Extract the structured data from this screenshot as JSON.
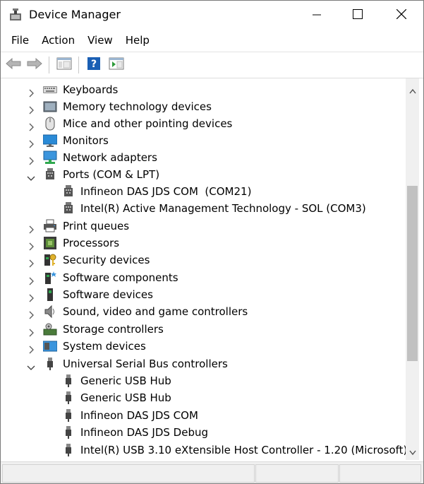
{
  "window": {
    "title": "Device Manager"
  },
  "menu": [
    {
      "label": "File"
    },
    {
      "label": "Action"
    },
    {
      "label": "View"
    },
    {
      "label": "Help"
    }
  ],
  "tree": {
    "items": [
      {
        "label": "Keyboards",
        "expanded": false,
        "level": 0,
        "icon": "keyboard-icon"
      },
      {
        "label": "Memory technology devices",
        "expanded": false,
        "level": 0,
        "icon": "memory-icon"
      },
      {
        "label": "Mice and other pointing devices",
        "expanded": false,
        "level": 0,
        "icon": "mouse-icon"
      },
      {
        "label": "Monitors",
        "expanded": false,
        "level": 0,
        "icon": "monitor-icon"
      },
      {
        "label": "Network adapters",
        "expanded": false,
        "level": 0,
        "icon": "network-adapter-icon"
      },
      {
        "label": "Ports (COM & LPT)",
        "expanded": true,
        "level": 0,
        "icon": "port-icon"
      },
      {
        "label": "Infineon DAS JDS COM  (COM21)",
        "level": 1,
        "icon": "port-icon"
      },
      {
        "label": "Intel(R) Active Management Technology - SOL (COM3)",
        "level": 1,
        "icon": "port-icon"
      },
      {
        "label": "Print queues",
        "expanded": false,
        "level": 0,
        "icon": "printer-icon"
      },
      {
        "label": "Processors",
        "expanded": false,
        "level": 0,
        "icon": "processor-icon"
      },
      {
        "label": "Security devices",
        "expanded": false,
        "level": 0,
        "icon": "security-key-icon"
      },
      {
        "label": "Software components",
        "expanded": false,
        "level": 0,
        "icon": "software-component-icon"
      },
      {
        "label": "Software devices",
        "expanded": false,
        "level": 0,
        "icon": "software-device-icon"
      },
      {
        "label": "Sound, video and game controllers",
        "expanded": false,
        "level": 0,
        "icon": "speaker-icon"
      },
      {
        "label": "Storage controllers",
        "expanded": false,
        "level": 0,
        "icon": "storage-controller-icon"
      },
      {
        "label": "System devices",
        "expanded": false,
        "level": 0,
        "icon": "system-device-icon"
      },
      {
        "label": "Universal Serial Bus controllers",
        "expanded": true,
        "level": 0,
        "icon": "usb-icon"
      },
      {
        "label": "Generic USB Hub",
        "level": 1,
        "icon": "usb-icon"
      },
      {
        "label": "Generic USB Hub",
        "level": 1,
        "icon": "usb-icon"
      },
      {
        "label": "Infineon DAS JDS COM",
        "level": 1,
        "icon": "usb-icon"
      },
      {
        "label": "Infineon DAS JDS Debug",
        "level": 1,
        "icon": "usb-icon"
      },
      {
        "label": "Intel(R) USB 3.10 eXtensible Host Controller - 1.20 (Microsoft)",
        "level": 1,
        "icon": "usb-icon"
      }
    ]
  },
  "colors": {
    "monitor": "#2a8ad6",
    "chevron": "#5a5a5a",
    "help": "#1a5fb4"
  }
}
